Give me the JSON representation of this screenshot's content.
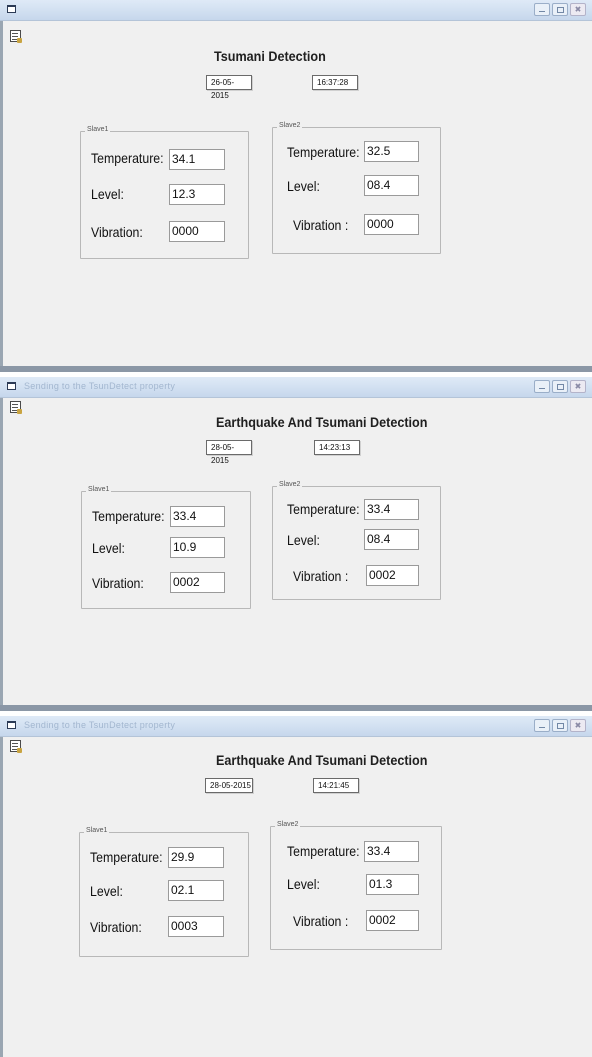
{
  "windows": [
    {
      "title": "",
      "heading": "Tsumani Detection",
      "date": "26-05-2015",
      "time": "16:37:28",
      "slave1": {
        "label": "Slave1",
        "temperature_label": "Temperature:",
        "temperature": "34.1",
        "level_label": "Level:",
        "level": "12.3",
        "vibration_label": "Vibration:",
        "vibration": "0000"
      },
      "slave2": {
        "label": "Slave2",
        "temperature_label": "Temperature:",
        "temperature": "32.5",
        "level_label": "Level:",
        "level": "08.4",
        "vibration_label": "Vibration :",
        "vibration": "0000"
      }
    },
    {
      "title": "Sending to the TsunDetect property",
      "heading": "Earthquake And Tsumani Detection",
      "date": "28-05-2015",
      "time": "14:23:13",
      "slave1": {
        "label": "Slave1",
        "temperature_label": "Temperature:",
        "temperature": "33.4",
        "level_label": "Level:",
        "level": "10.9",
        "vibration_label": "Vibration:",
        "vibration": "0002"
      },
      "slave2": {
        "label": "Slave2",
        "temperature_label": "Temperature:",
        "temperature": "33.4",
        "level_label": "Level:",
        "level": "08.4",
        "vibration_label": "Vibration :",
        "vibration": "0002"
      }
    },
    {
      "title": "Sending to the TsunDetect property",
      "heading": "Earthquake And Tsumani Detection",
      "date": "28-05-2015",
      "time": "14:21:45",
      "slave1": {
        "label": "Slave1",
        "temperature_label": "Temperature:",
        "temperature": "29.9",
        "level_label": "Level:",
        "level": "02.1",
        "vibration_label": "Vibration:",
        "vibration": "0003"
      },
      "slave2": {
        "label": "Slave2",
        "temperature_label": "Temperature:",
        "temperature": "33.4",
        "level_label": "Level:",
        "level": "01.3",
        "vibration_label": "Vibration :",
        "vibration": "0002"
      }
    }
  ],
  "icons": {
    "system_menu": "window-icon",
    "form": "form-icon",
    "minimize": "minimize-icon",
    "maximize": "maximize-icon",
    "close": "close-icon"
  }
}
